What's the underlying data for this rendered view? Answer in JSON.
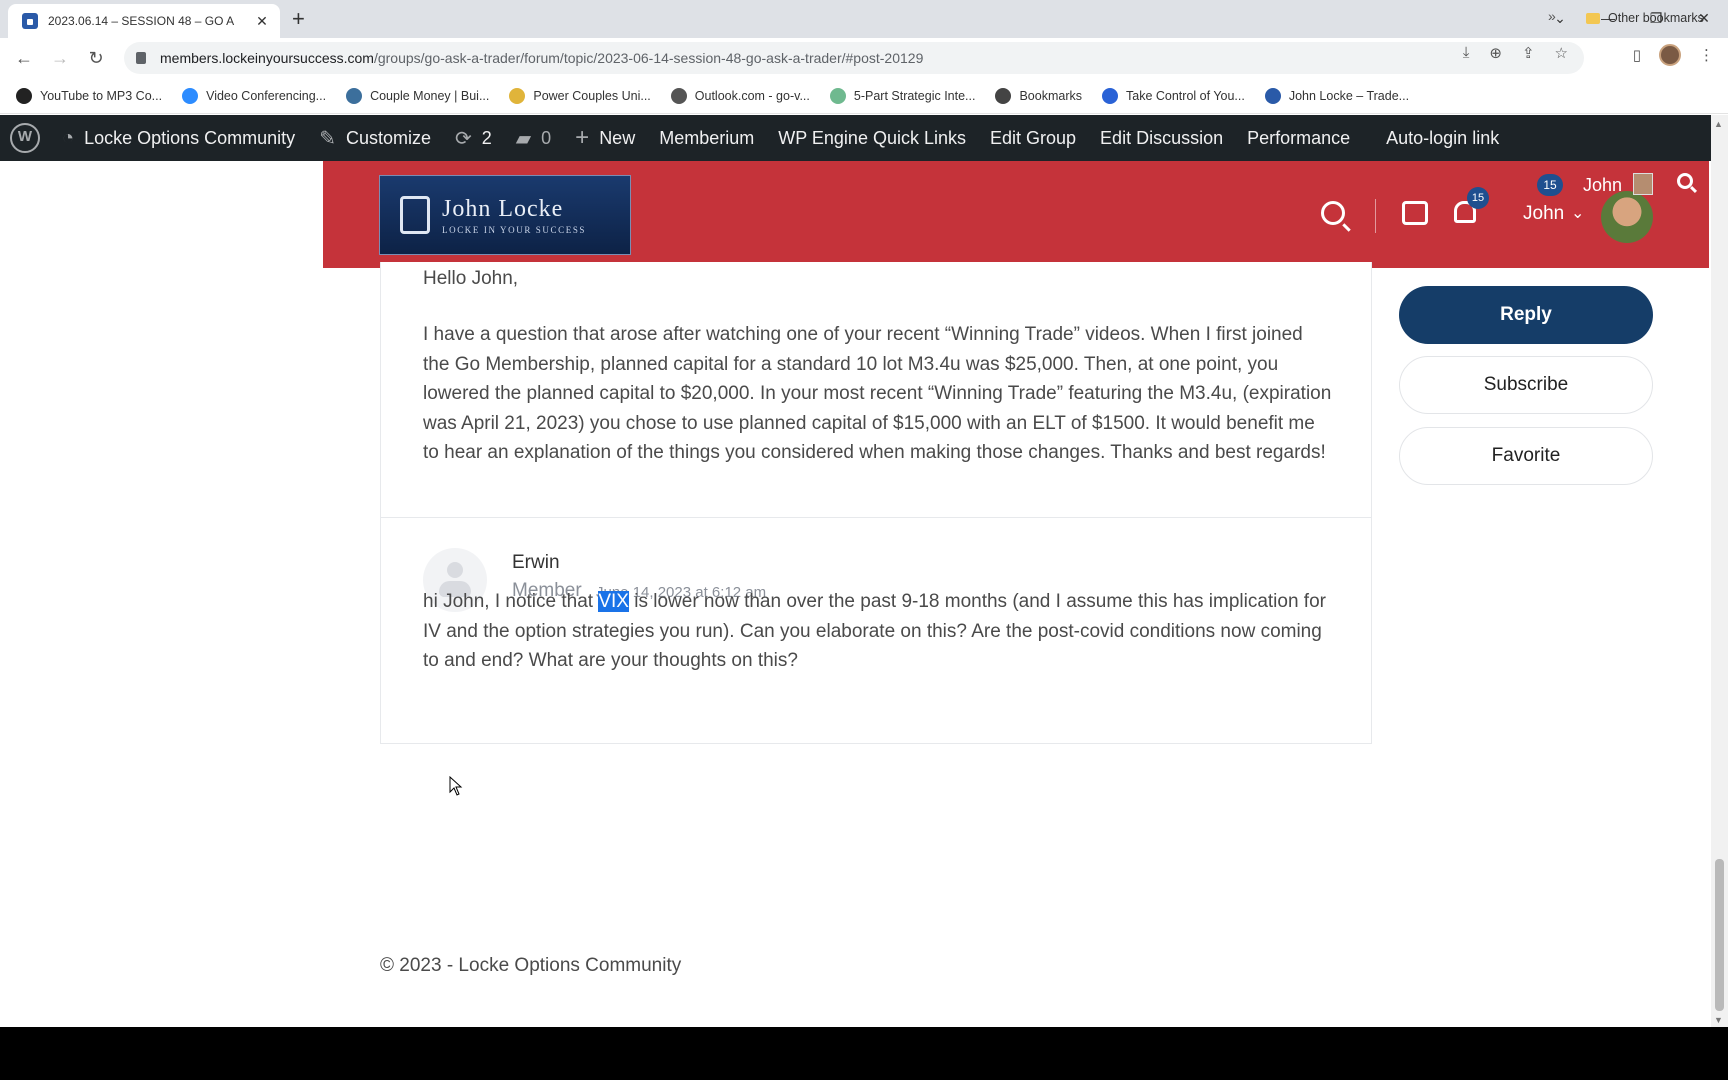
{
  "browser": {
    "tab_title": "2023.06.14 – SESSION 48 – GO A",
    "url_host": "members.lockeinyoursuccess.com",
    "url_path": "/groups/go-ask-a-trader/forum/topic/2023-06-14-session-48-go-ask-a-trader/#post-20129"
  },
  "bookmarks": {
    "items": [
      {
        "label": "YouTube to MP3 Co...",
        "icon": "music-note-icon",
        "color": "#222222"
      },
      {
        "label": "Video Conferencing...",
        "icon": "zoom-icon",
        "color": "#2d8cff"
      },
      {
        "label": "Couple Money | Bui...",
        "icon": "wordpress-icon",
        "color": "#3c6f9c"
      },
      {
        "label": "Power Couples Uni...",
        "icon": "badge-icon",
        "color": "#e0b43a"
      },
      {
        "label": "Outlook.com - go-v...",
        "icon": "globe-icon",
        "color": "#555555"
      },
      {
        "label": "5-Part Strategic Inte...",
        "icon": "circle-icon",
        "color": "#6fb98f"
      },
      {
        "label": "Bookmarks",
        "icon": "star-icon",
        "color": "#444444"
      },
      {
        "label": "Take Control of You...",
        "icon": "swirl-icon",
        "color": "#2a62d6"
      },
      {
        "label": "John Locke – Trade...",
        "icon": "lock-icon",
        "color": "#2a5aa8"
      }
    ],
    "overflow": "»",
    "other": "Other bookmarks"
  },
  "adminbar": {
    "site": "Locke Options Community",
    "customize": "Customize",
    "updates": "2",
    "comments": "0",
    "new": "New",
    "items": [
      "Memberium",
      "WP Engine Quick Links",
      "Edit Group",
      "Edit Discussion",
      "Performance",
      "Auto-login link"
    ]
  },
  "header": {
    "logo_name": "John Locke",
    "logo_tag": "LOCKE IN YOUR SUCCESS",
    "notif_count": "15",
    "user_name": "John",
    "mini_count": "15",
    "mini_name": "John"
  },
  "post1": {
    "greeting": "Hello John,",
    "body": "I have a question that arose after watching one of your recent “Winning Trade” videos. When I first joined the Go Membership, planned capital for a standard 10 lot M3.4u was $25,000. Then, at one point, you lowered the planned capital to $20,000. In your most recent “Winning Trade” featuring the M3.4u, (expiration was April 21, 2023) you chose to use planned capital of $15,000 with an ELT of $1500. It would benefit me to hear an explanation of the things you considered when making those changes. Thanks and best regards!"
  },
  "post2": {
    "author": "Erwin",
    "role": "Member",
    "date": "June 14, 2023 at 6:12 am",
    "body_before": "hi John, I notice that ",
    "body_highlight": "VIX",
    "body_after": " is lower now than over the past 9-18 months (and I assume this has implication for IV and the option strategies you run). Can you elaborate on this? Are the post-covid conditions now coming to and end? What are your thoughts on this?"
  },
  "sidebar": {
    "reply": "Reply",
    "subscribe": "Subscribe",
    "favorite": "Favorite"
  },
  "footer": {
    "text": "© 2023 - Locke Options Community"
  },
  "colors": {
    "header_red": "#c5333a",
    "reply_navy": "#153d68",
    "admin_bar": "#1d2327"
  }
}
